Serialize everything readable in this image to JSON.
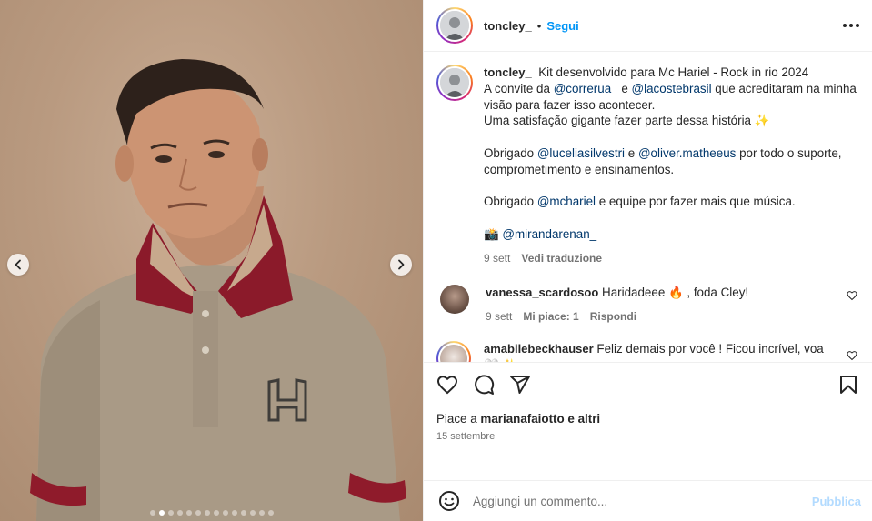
{
  "post": {
    "username": "toncley_",
    "separator": "•",
    "follow_label": "Segui"
  },
  "caption": {
    "username": "toncley_",
    "line1": "Kit desenvolvido para Mc Hariel - Rock in rio 2024",
    "line2_pre": "A convite da",
    "mention1": "@correrua_",
    "line2_mid": "e",
    "mention2": "@lacostebrasil",
    "line2_post": "que acreditaram na minha visão para fazer isso acontecer.",
    "line3": "Uma satisfação gigante fazer parte dessa história ✨",
    "line4_pre": "Obrigado",
    "mention3": "@luceliasilvestri",
    "line4_mid": "e",
    "mention4": "@oliver.matheeus",
    "line4_post": "por todo o suporte, comprometimento e ensinamentos.",
    "line5_pre": "Obrigado",
    "mention5": "@mchariel",
    "line5_post": "e equipe por fazer mais que música.",
    "camera": "📸",
    "mention6": "@mirandarenan_",
    "time": "9 sett",
    "translate": "Vedi traduzione"
  },
  "comments": [
    {
      "username": "vanessa_scardosoo",
      "text": "Haridadeee 🔥 , foda Cley!",
      "time": "9 sett",
      "likes": "Mi piace: 1",
      "reply": "Rispondi"
    },
    {
      "username": "amabilebeckhauser",
      "text": "Feliz demais por você ! Ficou incrível, voa 🤍 ✨"
    }
  ],
  "likes": {
    "prefix": "Piace a",
    "user": "marianafaiotto",
    "suffix": "e altri"
  },
  "date": "15 settembre",
  "add_comment": {
    "placeholder": "Aggiungi un commento...",
    "publish_label": "Pubblica"
  },
  "carousel": {
    "slide_count": 14,
    "active_index": 1
  },
  "colors": {
    "accent": "#0095f6",
    "mention": "#00376b",
    "muted": "#737373",
    "publish_disabled": "#b3dbff"
  },
  "icons": [
    "chevron-left-icon",
    "chevron-right-icon",
    "more-icon",
    "heart-icon",
    "comment-icon",
    "share-icon",
    "bookmark-icon",
    "emoji-icon"
  ]
}
